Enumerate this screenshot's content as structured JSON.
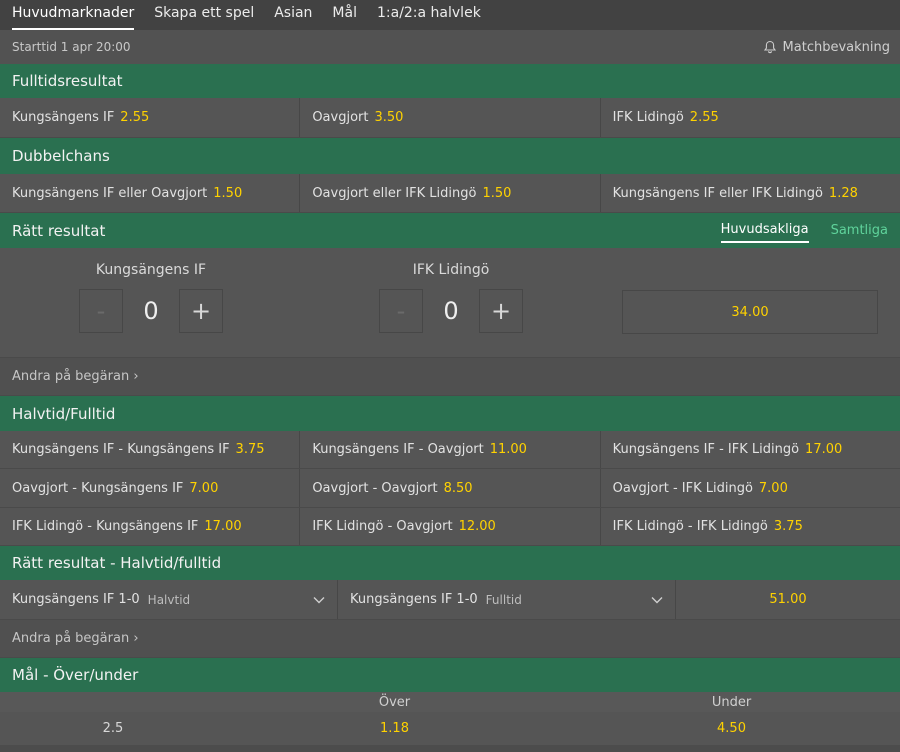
{
  "tabs": [
    "Huvudmarknader",
    "Skapa ett spel",
    "Asian",
    "Mål",
    "1:a/2:a halvlek"
  ],
  "start_time": "Starttid 1 apr 20:00",
  "notify_label": "Matchbevakning",
  "ft": {
    "title": "Fulltidsresultat",
    "cells": [
      {
        "label": "Kungsängens IF",
        "odds": "2.55"
      },
      {
        "label": "Oavgjort",
        "odds": "3.50"
      },
      {
        "label": "IFK Lidingö",
        "odds": "2.55"
      }
    ]
  },
  "dc": {
    "title": "Dubbelchans",
    "cells": [
      {
        "label": "Kungsängens IF eller Oavgjort",
        "odds": "1.50"
      },
      {
        "label": "Oavgjort eller IFK Lidingö",
        "odds": "1.50"
      },
      {
        "label": "Kungsängens IF eller IFK Lidingö",
        "odds": "1.28"
      }
    ]
  },
  "cs": {
    "title": "Rätt resultat",
    "tab_main": "Huvudsakliga",
    "tab_all": "Samtliga",
    "home": "Kungsängens IF",
    "away": "IFK Lidingö",
    "home_score": "0",
    "away_score": "0",
    "minus": "-",
    "plus": "+",
    "odds": "34.00",
    "more": "Andra på begäran ›"
  },
  "htft": {
    "title": "Halvtid/Fulltid",
    "rows": [
      [
        {
          "label": "Kungsängens IF - Kungsängens IF",
          "odds": "3.75"
        },
        {
          "label": "Kungsängens IF - Oavgjort",
          "odds": "11.00"
        },
        {
          "label": "Kungsängens IF - IFK Lidingö",
          "odds": "17.00"
        }
      ],
      [
        {
          "label": "Oavgjort - Kungsängens IF",
          "odds": "7.00"
        },
        {
          "label": "Oavgjort - Oavgjort",
          "odds": "8.50"
        },
        {
          "label": "Oavgjort - IFK Lidingö",
          "odds": "7.00"
        }
      ],
      [
        {
          "label": "IFK Lidingö - Kungsängens IF",
          "odds": "17.00"
        },
        {
          "label": "IFK Lidingö - Oavgjort",
          "odds": "12.00"
        },
        {
          "label": "IFK Lidingö - IFK Lidingö",
          "odds": "3.75"
        }
      ]
    ]
  },
  "csht": {
    "title": "Rätt resultat - Halvtid/fulltid",
    "sel1": {
      "value": "Kungsängens IF 1-0",
      "placeholder": "Halvtid"
    },
    "sel2": {
      "value": "Kungsängens IF 1-0",
      "placeholder": "Fulltid"
    },
    "odds": "51.00",
    "more": "Andra på begäran ›"
  },
  "ou": {
    "title": "Mål - Över/under",
    "col_over": "Över",
    "col_under": "Under",
    "line": "2.5",
    "over": "1.18",
    "under": "4.50"
  },
  "colors": {
    "header_green": "#2a7050",
    "odds_yellow": "#ffd200",
    "tab_green": "#5fd39b",
    "background": "#4c4c4c"
  }
}
